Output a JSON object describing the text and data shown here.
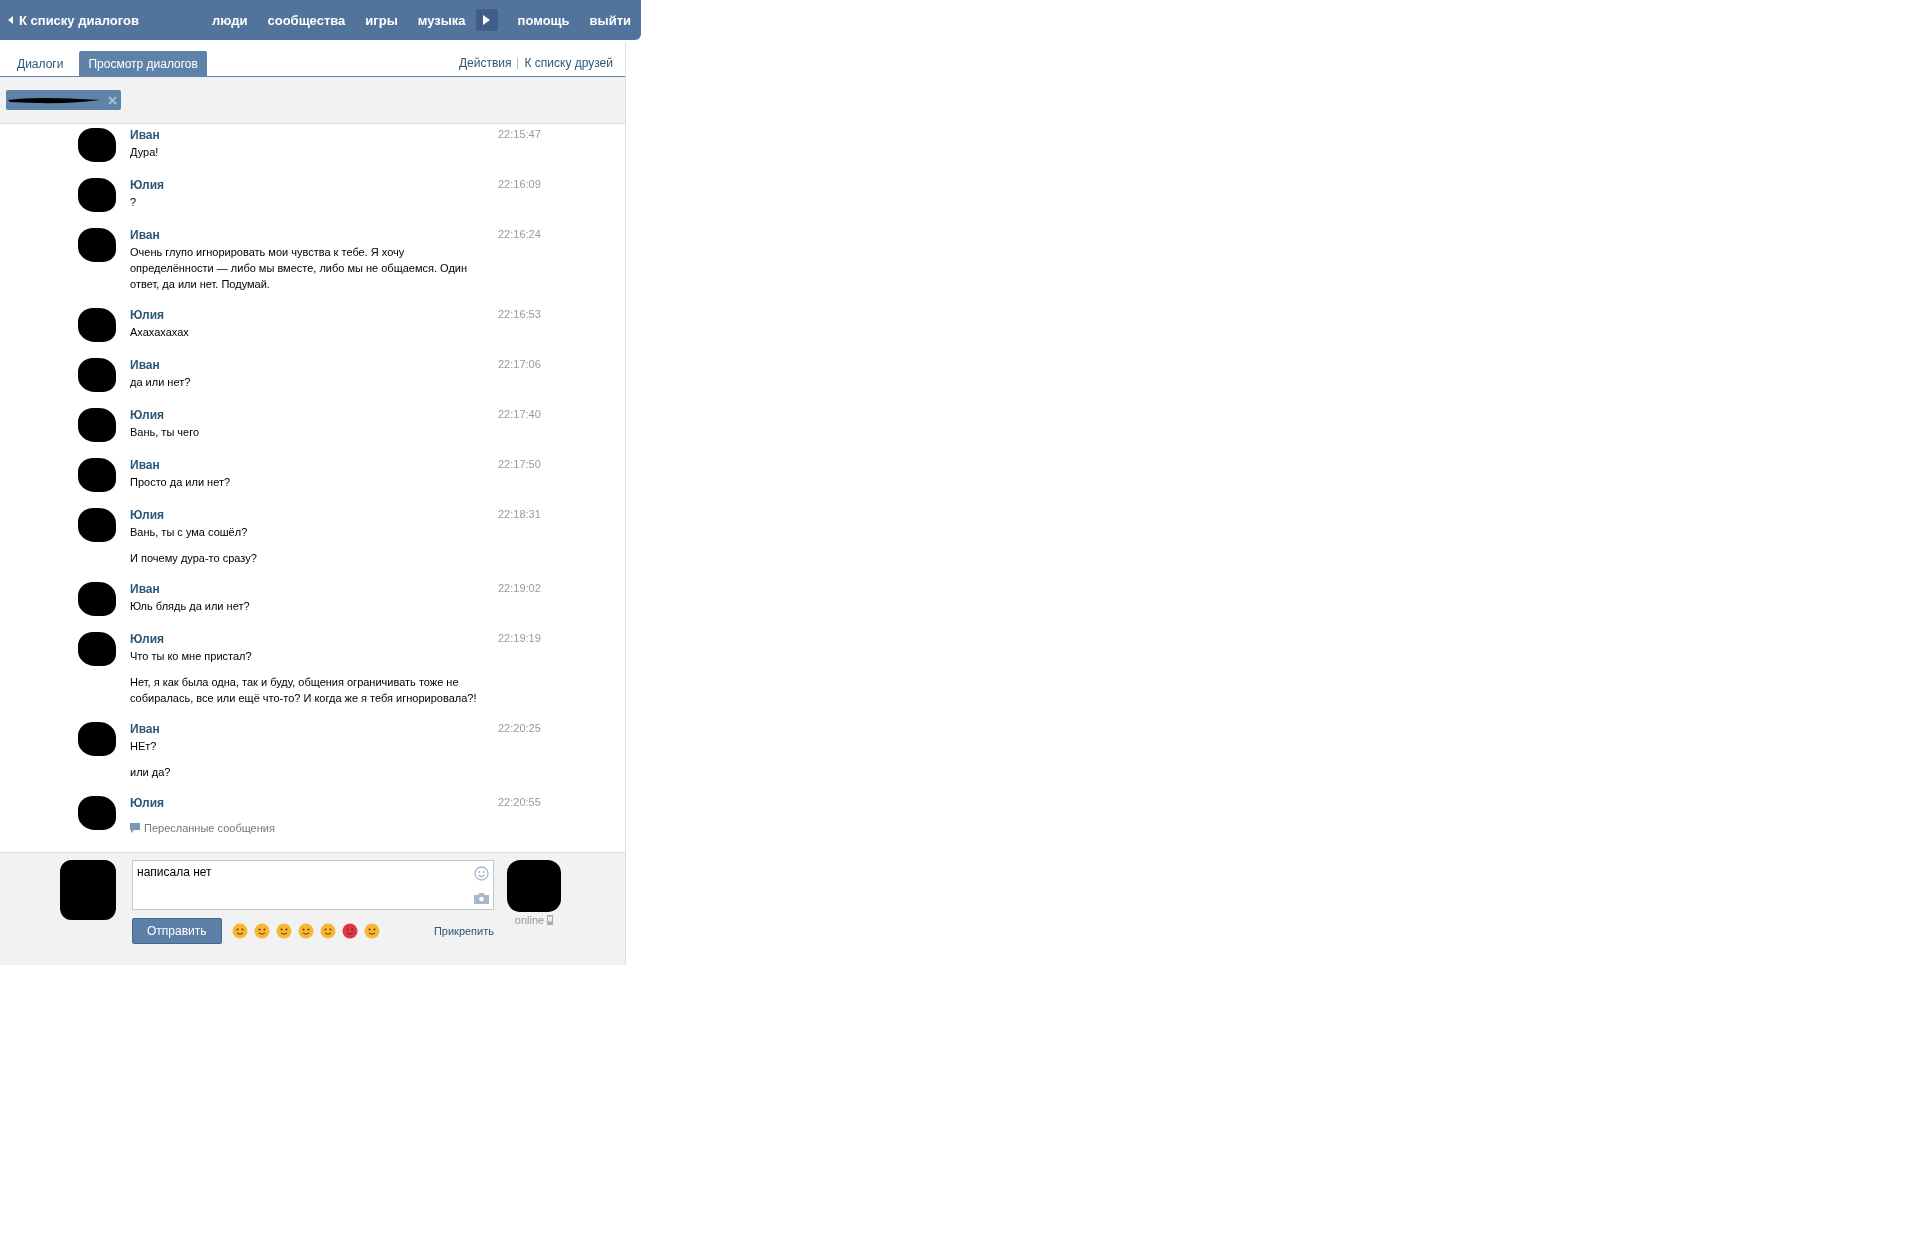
{
  "header": {
    "back_link": "К списку диалогов",
    "nav": [
      "люди",
      "сообщества",
      "игры",
      "музыка"
    ],
    "nav_right": [
      "помощь",
      "выйти"
    ]
  },
  "tabs": [
    {
      "label": "Диалоги",
      "selected": false
    },
    {
      "label": "Просмотр диалогов",
      "selected": true
    }
  ],
  "tab_links": [
    "Действия",
    "К списку друзей"
  ],
  "messages": [
    {
      "author": "Иван",
      "time": "22:15:47",
      "paragraphs": [
        "Дура!"
      ]
    },
    {
      "author": "Юлия",
      "time": "22:16:09",
      "paragraphs": [
        "?"
      ]
    },
    {
      "author": "Иван",
      "time": "22:16:24",
      "paragraphs": [
        "Очень глупо игнорировать мои чувства к тебе. Я хочу определённости — либо мы вместе, либо мы не общаемся. Один ответ, да или нет. Подумай."
      ]
    },
    {
      "author": "Юлия",
      "time": "22:16:53",
      "paragraphs": [
        "Ахахахахах"
      ]
    },
    {
      "author": "Иван",
      "time": "22:17:06",
      "paragraphs": [
        "да или нет?"
      ]
    },
    {
      "author": "Юлия",
      "time": "22:17:40",
      "paragraphs": [
        "Вань, ты чего"
      ]
    },
    {
      "author": "Иван",
      "time": "22:17:50",
      "paragraphs": [
        "Просто да или нет?"
      ]
    },
    {
      "author": "Юлия",
      "time": "22:18:31",
      "paragraphs": [
        "Вань, ты с ума сошёл?",
        "И почему дура-то сразу?"
      ]
    },
    {
      "author": "Иван",
      "time": "22:19:02",
      "paragraphs": [
        "Юль блядь да или нет?"
      ]
    },
    {
      "author": "Юлия",
      "time": "22:19:19",
      "paragraphs": [
        "Что ты ко мне пристал?",
        "Нет, я как была одна, так и буду, общения ограничивать тоже не собиралась, все или ещё что-то? И когда же я тебя игнорировала?!"
      ]
    },
    {
      "author": "Иван",
      "time": "22:20:25",
      "paragraphs": [
        "НЕт?",
        "или да?"
      ]
    },
    {
      "author": "Юлия",
      "time": "22:20:55",
      "forwarded": "Пересланные сообщения"
    }
  ],
  "composer": {
    "value": "написала нет",
    "send_button": "Отправить",
    "attach_link": "Прикрепить",
    "status": "online"
  }
}
